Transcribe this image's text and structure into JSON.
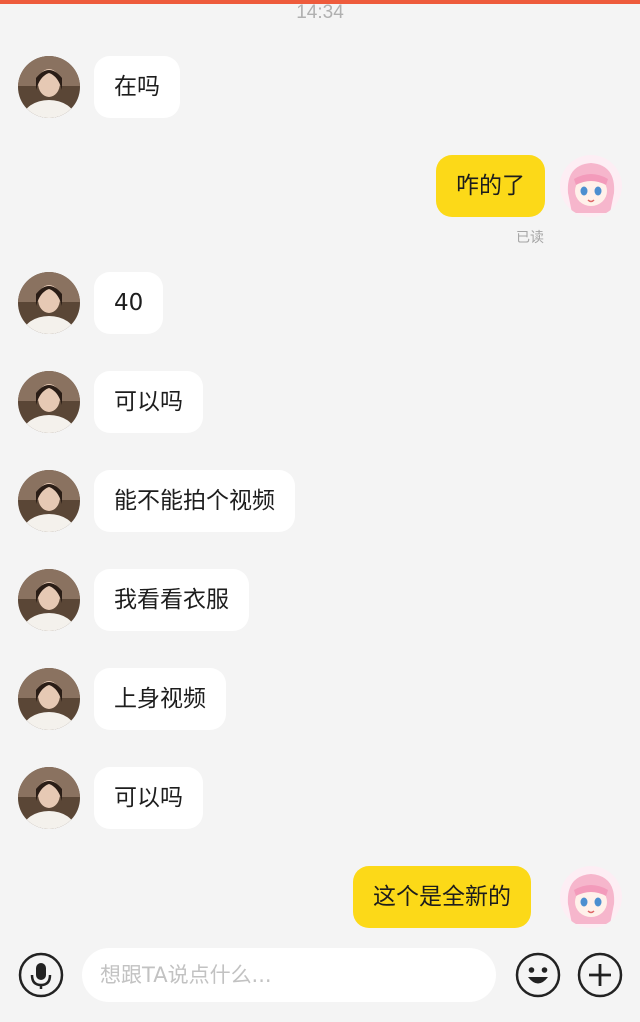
{
  "status": {
    "time": "14:34"
  },
  "messages": [
    {
      "side": "in",
      "text": "在吗"
    },
    {
      "side": "out",
      "text": "咋的了",
      "receipt": "已读"
    },
    {
      "side": "in",
      "text": "40"
    },
    {
      "side": "in",
      "text": "可以吗"
    },
    {
      "side": "in",
      "text": "能不能拍个视频"
    },
    {
      "side": "in",
      "text": "我看看衣服"
    },
    {
      "side": "in",
      "text": "上身视频"
    },
    {
      "side": "in",
      "text": "可以吗"
    },
    {
      "side": "out",
      "text": "这个是全新的"
    }
  ],
  "composer": {
    "placeholder": "想跟TA说点什么...",
    "left_icon": "microphone-icon",
    "right_icons": [
      "emoji-icon",
      "add-icon"
    ]
  },
  "colors": {
    "accent_top": "#ee5b3c",
    "outgoing_bubble": "#fcd918",
    "incoming_bubble": "#ffffff",
    "background": "#f4f4f4"
  }
}
